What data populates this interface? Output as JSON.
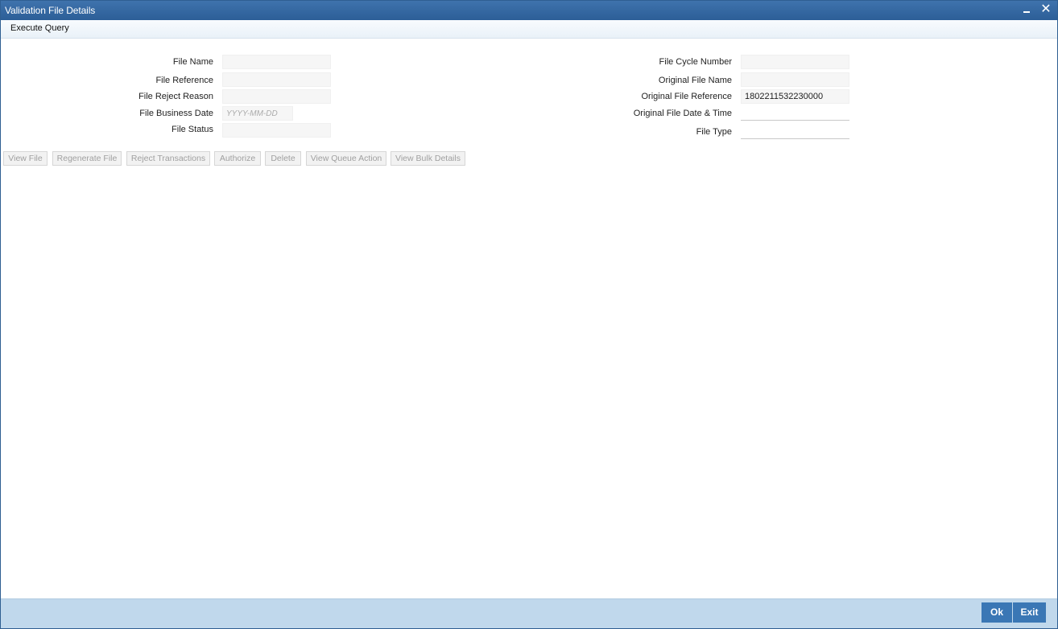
{
  "window": {
    "title": "Validation File Details",
    "minimize_icon": "minimize-icon",
    "close_icon": "close-icon",
    "close_glyph": "✕"
  },
  "menu": {
    "execute_query": "Execute Query"
  },
  "form": {
    "left": {
      "file_name": {
        "label": "File Name",
        "value": ""
      },
      "file_reference": {
        "label": "File Reference",
        "value": ""
      },
      "file_reject_reason": {
        "label": "File Reject Reason",
        "value": ""
      },
      "file_business_date": {
        "label": "File Business Date",
        "value": "",
        "placeholder": "YYYY-MM-DD"
      },
      "file_status": {
        "label": "File Status",
        "value": ""
      }
    },
    "right": {
      "file_cycle_number": {
        "label": "File Cycle Number",
        "value": ""
      },
      "original_file_name": {
        "label": "Original File Name",
        "value": ""
      },
      "original_file_reference": {
        "label": "Original File Reference",
        "value": "1802211532230000"
      },
      "original_file_date_time": {
        "label": "Original File Date & Time",
        "value": ""
      },
      "file_type": {
        "label": "File Type",
        "value": ""
      }
    }
  },
  "actions": {
    "view_file": "View File",
    "regenerate_file": "Regenerate File",
    "reject_transactions": "Reject Transactions",
    "authorize": "Authorize",
    "delete": "Delete",
    "view_queue_action": "View Queue Action",
    "view_bulk_details": "View Bulk Details"
  },
  "footer": {
    "ok": "Ok",
    "exit": "Exit"
  },
  "colors": {
    "titlebar": "#3f73ad",
    "footer": "#c0d8ec",
    "button_primary": "#3a77b5"
  }
}
